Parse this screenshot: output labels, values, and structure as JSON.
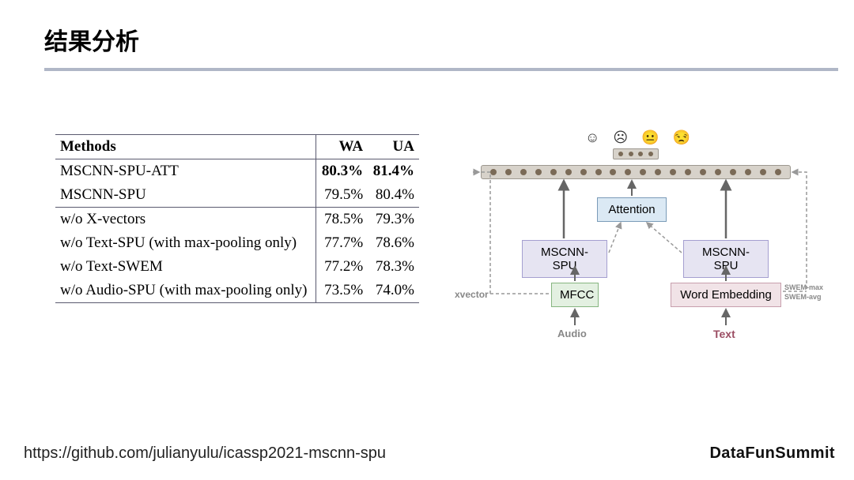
{
  "title": "结果分析",
  "table": {
    "headers": {
      "method": "Methods",
      "wa": "WA",
      "ua": "UA"
    },
    "rows": [
      {
        "method": "MSCNN-SPU-ATT",
        "wa": "80.3%",
        "ua": "81.4%",
        "bold": true
      },
      {
        "method": "MSCNN-SPU",
        "wa": "79.5%",
        "ua": "80.4%"
      },
      {
        "method": "w/o X-vectors",
        "wa": "78.5%",
        "ua": "79.3%",
        "sep": true
      },
      {
        "method": "w/o Text-SPU (with max-pooling only)",
        "wa": "77.7%",
        "ua": "78.6%"
      },
      {
        "method": "w/o Text-SWEM",
        "wa": "77.2%",
        "ua": "78.3%"
      },
      {
        "method": "w/o Audio-SPU (with max-pooling only)",
        "wa": "73.5%",
        "ua": "74.0%"
      }
    ]
  },
  "diagram": {
    "attention": "Attention",
    "mscnn_spu": "MSCNN-SPU",
    "mfcc": "MFCC",
    "word_embedding": "Word Embedding",
    "xvector": "xvector",
    "audio": "Audio",
    "text": "Text",
    "swem_max": "SWEM-max",
    "swem_avg": "SWEM-avg",
    "emoji": "☺  ☹  😐  😒"
  },
  "footer": {
    "url": "https://github.com/julianyulu/icassp2021-mscnn-spu",
    "brand": "DataFunSummit"
  }
}
